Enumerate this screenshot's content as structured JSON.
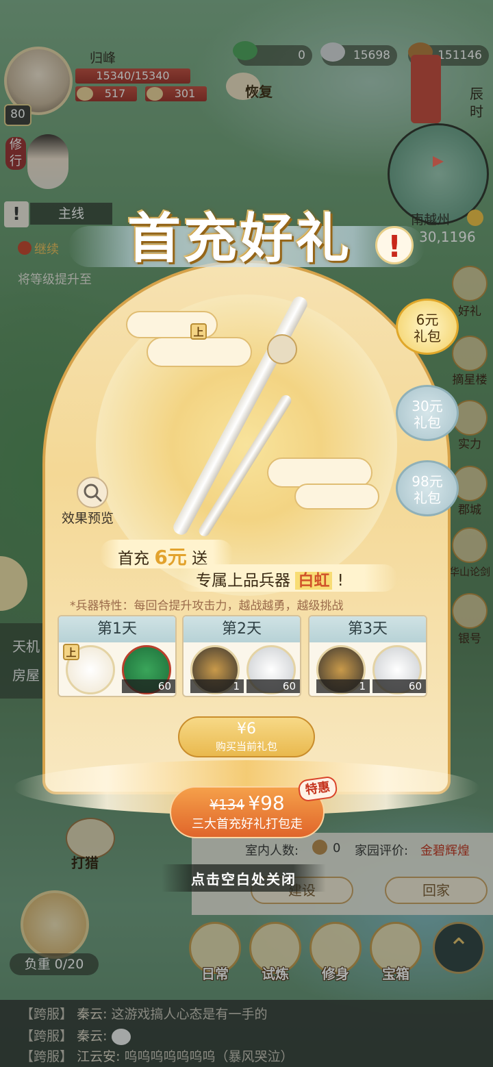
{
  "hud": {
    "player_name": "归峰",
    "level": "80",
    "hp": "15340/15340",
    "stat1": "517",
    "stat2": "301",
    "res_jade": "0",
    "res_silver": "15698",
    "res_copper": "151146",
    "recover": "恢复",
    "time": "辰时",
    "cultivate": "修行",
    "region": "南越州",
    "coords": "30,1196"
  },
  "quest": {
    "tab": "主线",
    "title": "继续",
    "desc": "将等级提升至"
  },
  "side_left": [
    "天机",
    "房屋"
  ],
  "popup": {
    "title": "首充好礼",
    "title_mark": "!",
    "grade": "上",
    "preview": "效果预览",
    "gift_line1_a": "首充",
    "gift_line1_amount": "6元",
    "gift_line1_b": "送",
    "gift_line2_a": "专属上品兵器",
    "gift_line2_weapon": "白虹",
    "gift_line2_b": "!",
    "weapon_trait": "*兵器特性：每回合提升攻击力，越战越勇，越级挑战",
    "days": [
      {
        "label": "第1天",
        "items": [
          {
            "name": "白虹剑",
            "qty": ""
          },
          {
            "name": "玉石",
            "qty": "60"
          }
        ]
      },
      {
        "label": "第2天",
        "items": [
          {
            "name": "矿石",
            "qty": "1"
          },
          {
            "name": "银锭",
            "qty": "60"
          }
        ]
      },
      {
        "label": "第3天",
        "items": [
          {
            "name": "矿石",
            "qty": "1"
          },
          {
            "name": "银锭",
            "qty": "60"
          }
        ]
      }
    ],
    "buy_price": "¥6",
    "buy_label": "购买当前礼包",
    "bundle_old": "¥134",
    "bundle_new": "¥98",
    "bundle_label": "三大首充好礼打包走",
    "special": "特惠",
    "close_hint": "点击空白处关闭",
    "tabs": [
      {
        "label1": "6元",
        "label2": "礼包",
        "active": true
      },
      {
        "label1": "30元",
        "label2": "礼包",
        "active": false
      },
      {
        "label1": "98元",
        "label2": "礼包",
        "active": false
      }
    ]
  },
  "right_menu": [
    "好礼",
    "摘星楼",
    "实力",
    "郡城",
    "论剑",
    "华山论剑",
    "银号"
  ],
  "home": {
    "people_label": "室内人数:",
    "people_count": "0",
    "rating_label": "家园评价:",
    "rating_value": "金碧辉煌",
    "build": "建设",
    "back": "回家"
  },
  "bottom": {
    "hunt": "打猎",
    "load": "负重 0/20",
    "nav": [
      "日常",
      "试炼",
      "修身",
      "宝箱"
    ]
  },
  "chat": [
    {
      "channel": "【跨服】",
      "name": "秦云:",
      "text": "这游戏搞人心态是有一手的"
    },
    {
      "channel": "【跨服】",
      "name": "秦云:",
      "text": ""
    },
    {
      "channel": "【跨服】",
      "name": "江云安:",
      "text": "呜呜呜呜呜呜呜（暴风哭泣）"
    }
  ],
  "colors": {
    "accent_gold": "#e2a22c",
    "bundle_orange": "#e0652a",
    "hp_red": "#c24a3d",
    "day_header": "#cfe2e4"
  }
}
